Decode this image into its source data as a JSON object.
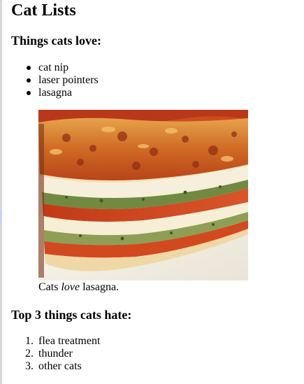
{
  "page": {
    "title": "Cat Lists"
  },
  "loves": {
    "heading": "Things cats love:",
    "items": [
      "cat nip",
      "laser pointers",
      "lasagna"
    ]
  },
  "figure": {
    "image_subject": "lasagna-photo",
    "caption_before": "Cats ",
    "caption_emphasis": "love",
    "caption_after": " lasagna."
  },
  "hates": {
    "heading": "Top 3 things cats hate:",
    "items": [
      "flea treatment",
      "thunder",
      "other cats"
    ],
    "numbers": [
      "1.",
      "2.",
      "3."
    ]
  },
  "colors": {
    "sauce": "#c8431a",
    "cheese_crust": "#d98a35",
    "pasta": "#f4e2b8",
    "ricotta": "#f6f1e2",
    "spinach": "#4f6b2a",
    "plate": "#f7f5ef"
  }
}
